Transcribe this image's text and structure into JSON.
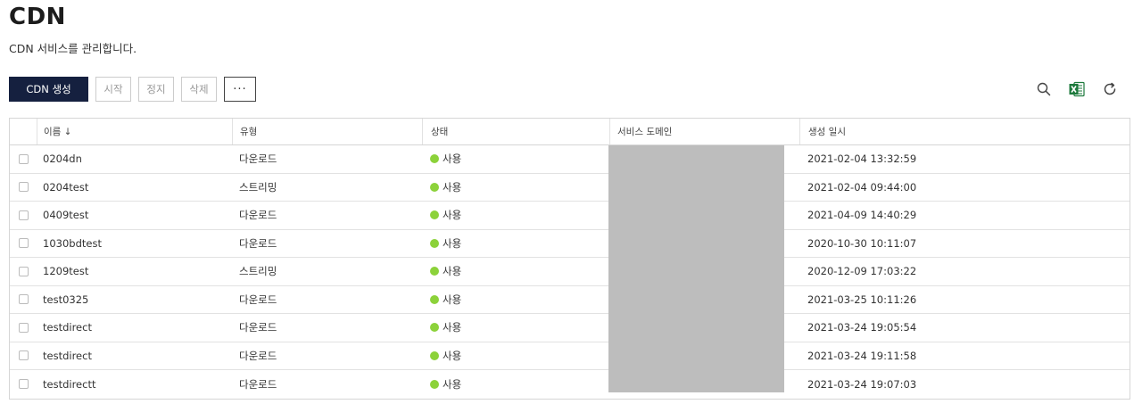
{
  "page": {
    "title": "CDN",
    "subtitle": "CDN 서비스를 관리합니다."
  },
  "toolbar": {
    "create_label": "CDN 생성",
    "start_label": "시작",
    "stop_label": "정지",
    "delete_label": "삭제",
    "more_label": "···"
  },
  "tools": {
    "search_icon": "search-icon",
    "excel_icon": "excel-icon",
    "refresh_icon": "refresh-icon",
    "excel_color": "#1d7a3c"
  },
  "table": {
    "headers": {
      "name": "이름 ↓",
      "type": "유형",
      "status": "상태",
      "domain": "서비스 도메인",
      "created": "생성 일시"
    },
    "status_color": "#8cd23a",
    "rows": [
      {
        "name": "0204dn",
        "type": "다운로드",
        "status": "사용",
        "created": "2021-02-04 13:32:59"
      },
      {
        "name": "0204test",
        "type": "스트리밍",
        "status": "사용",
        "created": "2021-02-04 09:44:00"
      },
      {
        "name": "0409test",
        "type": "다운로드",
        "status": "사용",
        "created": "2021-04-09 14:40:29"
      },
      {
        "name": "1030bdtest",
        "type": "다운로드",
        "status": "사용",
        "created": "2020-10-30 10:11:07"
      },
      {
        "name": "1209test",
        "type": "스트리밍",
        "status": "사용",
        "created": "2020-12-09 17:03:22"
      },
      {
        "name": "test0325",
        "type": "다운로드",
        "status": "사용",
        "created": "2021-03-25 10:11:26"
      },
      {
        "name": "testdirect",
        "type": "다운로드",
        "status": "사용",
        "created": "2021-03-24 19:05:54"
      },
      {
        "name": "testdirect",
        "type": "다운로드",
        "status": "사용",
        "created": "2021-03-24 19:11:58"
      },
      {
        "name": "testdirectt",
        "type": "다운로드",
        "status": "사용",
        "created": "2021-03-24 19:07:03"
      }
    ]
  }
}
